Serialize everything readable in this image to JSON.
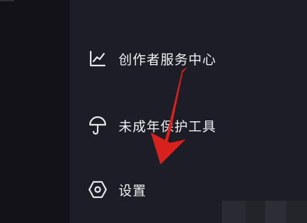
{
  "menu": {
    "items": [
      {
        "label": "创作者服务中心",
        "icon": "chart-line-icon"
      },
      {
        "label": "未成年保护工具",
        "icon": "umbrella-icon"
      },
      {
        "label": "设置",
        "icon": "settings-hexagon-icon"
      }
    ]
  },
  "annotation": {
    "arrow_color": "#d8201c",
    "description_icon": "red-arrow-icon"
  },
  "colors": {
    "background": "#1c1d27",
    "side": "#121218",
    "text": "#f1f1f3"
  }
}
